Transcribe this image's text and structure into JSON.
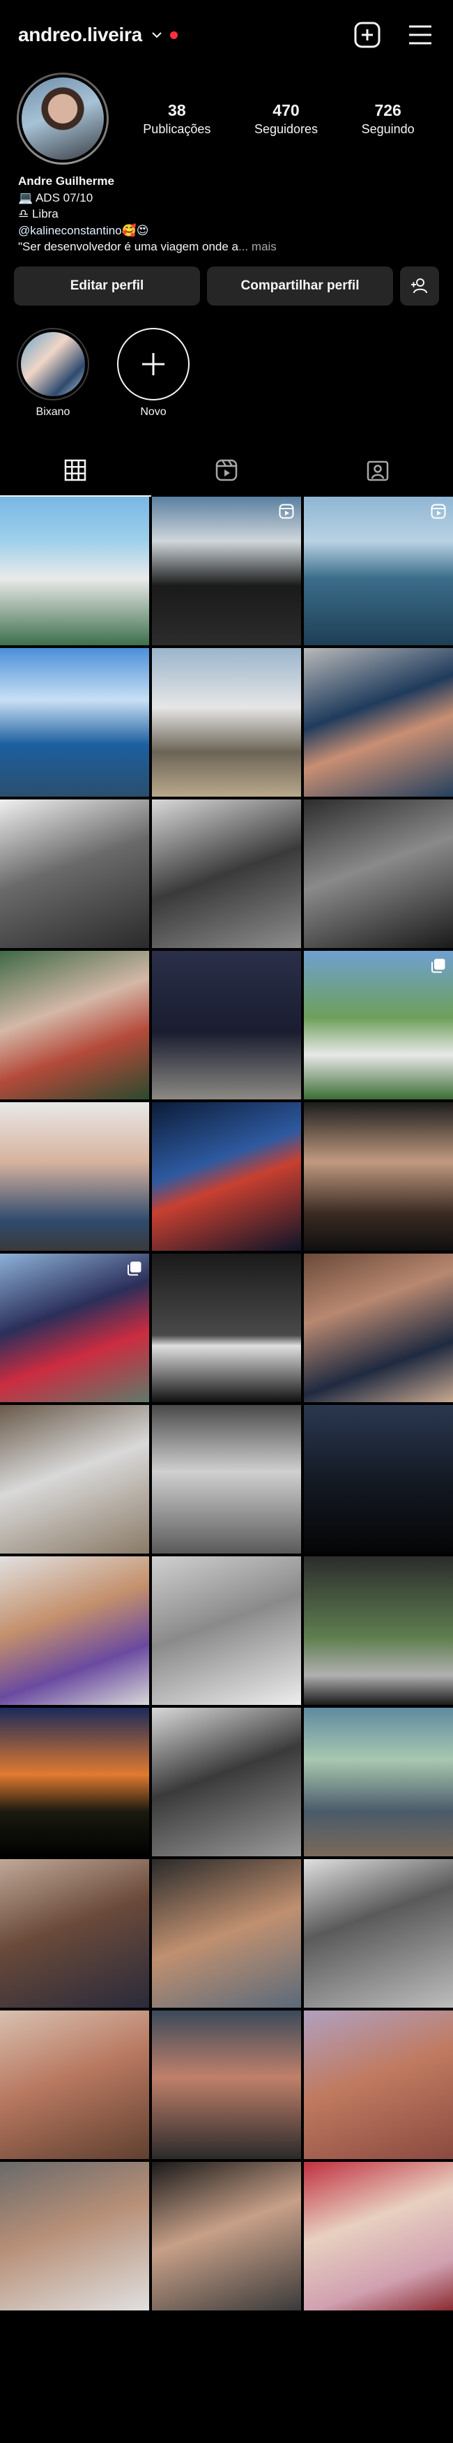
{
  "profile": {
    "username": "andreo.liveira",
    "posts_count": "38",
    "posts_label": "Publicações",
    "followers_count": "470",
    "followers_label": "Seguidores",
    "following_count": "726",
    "following_label": "Seguindo"
  },
  "bio": {
    "name": "Andre Guilherme",
    "line1": "💻 ADS 07/10",
    "line2": "♎ Libra",
    "line3": "@kalineconstantino🥰😍",
    "line4": "\"Ser desenvolvedor é uma viagem onde a",
    "more": "... mais"
  },
  "actions": {
    "edit_profile": "Editar perfil",
    "share_profile": "Compartilhar perfil"
  },
  "highlights": [
    {
      "label": "Bixano"
    },
    {
      "label": "Novo"
    }
  ],
  "colors": {
    "background": "#000000",
    "button_bg": "#262626",
    "notification_dot": "#ff3040"
  },
  "icons": {
    "top": [
      "chevron-down-icon",
      "create-post-icon",
      "menu-icon"
    ],
    "tabs": [
      "grid-icon",
      "reels-icon",
      "tagged-icon"
    ]
  },
  "grid": {
    "posts": [
      {
        "bg": "linear-gradient(180deg,#78b7e6 0%,#9fd0ea 30%,#eaeaea 55%,#3e6f4c 100%)"
      },
      {
        "bg": "linear-gradient(180deg,#5a7fa0 0%,#cfd7db 30%,#1a1a1a 60%,#2c2c2c 100%)",
        "badge": "reel"
      },
      {
        "bg": "linear-gradient(180deg,#8fb6d4 0%,#b9d2e3 30%,#3b6d8a 55%,#1e3f55 100%)",
        "badge": "reel"
      },
      {
        "bg": "linear-gradient(180deg,#4a8fd8 0%,#c9e0f5 35%,#1c5fa0 65%,#2a4f6e 100%)"
      },
      {
        "bg": "linear-gradient(180deg,#9bb5cc 0%,#e6e6e6 40%,#6b6456 70%,#b9a98c 100%)"
      },
      {
        "bg": "linear-gradient(160deg,#b9b9b9 0%,#1f3b5c 40%,#c98f73 60%,#24405f 100%)"
      },
      {
        "bg": "linear-gradient(160deg,#f0f0f0 0%,#6a6a6a 45%,#2a2a2a 100%)"
      },
      {
        "bg": "linear-gradient(160deg,#d9d9d9 0%,#3a3a3a 50%,#8d8d8d 100%)"
      },
      {
        "bg": "linear-gradient(160deg,#2d2d2d 0%,#8a8a8a 45%,#1a1a1a 100%)"
      },
      {
        "bg": "linear-gradient(160deg,#3f6a46 0%,#d4b8a8 40%,#b44a3a 65%,#2b4a2e 100%)"
      },
      {
        "bg": "linear-gradient(180deg,#2a2f48 0%,#1a1d30 55%,#8d8a84 100%)"
      },
      {
        "bg": "linear-gradient(180deg,#6fa0d0 0%,#6ea05a 45%,#e8e8e8 70%,#3c6d35 100%)",
        "badge": "square"
      },
      {
        "bg": "linear-gradient(180deg,#e8e8e8 0%,#d7b39e 40%,#2f4a6e 80%,#3a3a3a 100%)"
      },
      {
        "bg": "linear-gradient(160deg,#0c1c38 0%,#2e5aa0 40%,#c84030 55%,#0c1428 100%)"
      },
      {
        "bg": "linear-gradient(180deg,#1c1c1c 0%,#c19a80 40%,#3a2a22 75%,#0f0f0f 100%)"
      },
      {
        "bg": "linear-gradient(160deg,#8db2d8 0%,#2b2f5a 40%,#cc2c40 65%,#5f7a6a 100%)",
        "badge": "square"
      },
      {
        "bg": "linear-gradient(180deg,#1a1a1a 0%,#4a4a4a 55%,#e0e0e0 62%,#111 100%)"
      },
      {
        "bg": "linear-gradient(160deg,#6b4a3a 0%,#b88870 35%,#1f2a40 70%,#c8a890 100%)"
      },
      {
        "bg": "linear-gradient(160deg,#6a5a4a 0%,#d9d9d9 45%,#8a7a66 100%)"
      },
      {
        "bg": "linear-gradient(180deg,#4a4a4a 0%,#d0d0d0 45%,#5a5a5a 100%)"
      },
      {
        "bg": "linear-gradient(180deg,#2a3850 0%,#141a24 50%,#050505 100%)"
      },
      {
        "bg": "linear-gradient(160deg,#e0e0e0 0%,#c4906c 40%,#6a4aa0 70%,#d8d8d8 100%)"
      },
      {
        "bg": "linear-gradient(160deg,#d0d0d0 0%,#8a8a8a 45%,#ededed 100%)"
      },
      {
        "bg": "linear-gradient(180deg,#2c2c2c 0%,#5f7f50 55%,#b0b0b0 80%,#1a1a1a 100%)"
      },
      {
        "bg": "linear-gradient(180deg,#1b2a5a 0%,#e07a30 45%,#1a1a10 70%,#000 100%)"
      },
      {
        "bg": "linear-gradient(160deg,#d8d8d8 0%,#3a3a3a 45%,#9a9a9a 100%)"
      },
      {
        "bg": "linear-gradient(180deg,#5f8aa0 0%,#a8c8b0 35%,#4a5a6a 70%,#7a6a5a 100%)"
      },
      {
        "bg": "linear-gradient(160deg,#c0a898 0%,#6a4a3a 45%,#2a2a3a 100%)"
      },
      {
        "bg": "linear-gradient(160deg,#2a2a2a 0%,#c09070 50%,#5a6a7a 100%)"
      },
      {
        "bg": "linear-gradient(160deg,#e0e0e0 0%,#5a5a5a 40%,#bdbdbd 100%)"
      },
      {
        "bg": "linear-gradient(160deg,#d8c0b0 0%,#b87860 45%,#604030 100%)"
      },
      {
        "bg": "linear-gradient(180deg,#3a4a5a 0%,#c0806a 45%,#2a2a2a 100%)"
      },
      {
        "bg": "linear-gradient(160deg,#b0a0c0 0%,#c07a60 45%,#8a4a40 100%)"
      },
      {
        "bg": "linear-gradient(160deg,#6a6a6a 0%,#b89078 45%,#e0e0e0 100%)"
      },
      {
        "bg": "linear-gradient(160deg,#1a1a1a 0%,#c8a088 45%,#3a3a3a 100%)"
      },
      {
        "bg": "linear-gradient(160deg,#c03040 0%,#e8d0c0 40%,#d0a0b0 75%,#8a2a30 100%)"
      }
    ]
  }
}
